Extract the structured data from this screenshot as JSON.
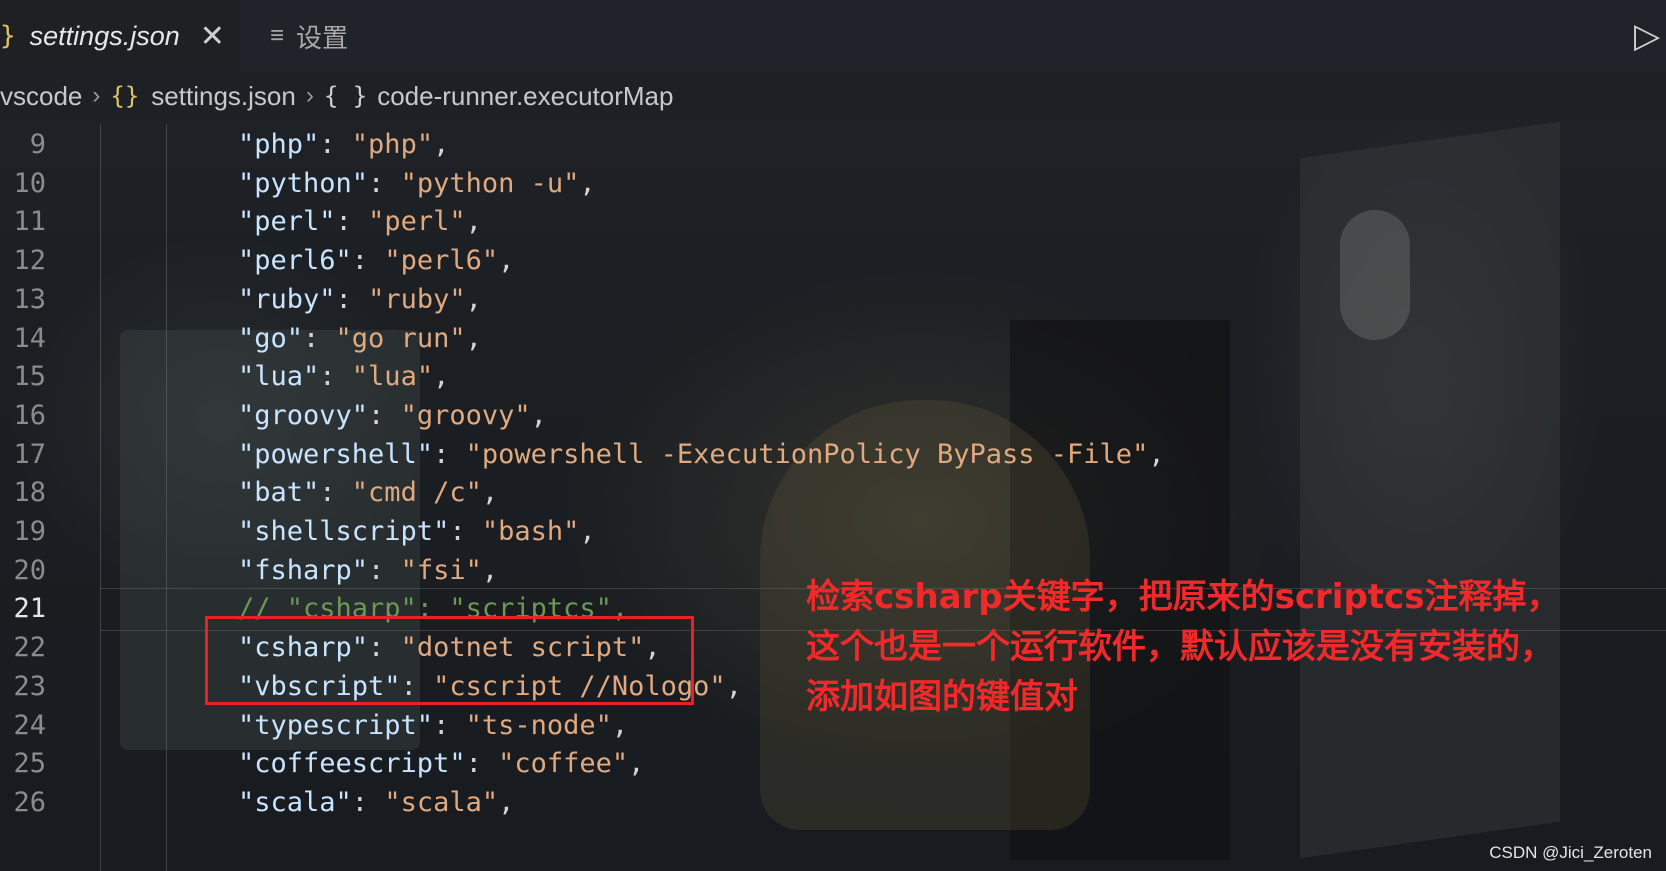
{
  "tabs": {
    "active": {
      "icon": "json-braces-icon",
      "icon_glyph": "}",
      "title": "settings.json",
      "close": "✕"
    },
    "settings": {
      "icon": "menu-lines-icon",
      "icon_glyph": "≡",
      "title": "设置"
    },
    "run_glyph": "▷"
  },
  "breadcrumb": {
    "folder": "vscode",
    "sep1": "›",
    "file_icon": "{}",
    "file": "settings.json",
    "sep2": "›",
    "obj_icon": "{ }",
    "key": "code-runner.executorMap"
  },
  "lines": [
    {
      "n": "9",
      "k": "\"php\"",
      "v": "\"php\""
    },
    {
      "n": "10",
      "k": "\"python\"",
      "v": "\"python -u\""
    },
    {
      "n": "11",
      "k": "\"perl\"",
      "v": "\"perl\""
    },
    {
      "n": "12",
      "k": "\"perl6\"",
      "v": "\"perl6\""
    },
    {
      "n": "13",
      "k": "\"ruby\"",
      "v": "\"ruby\""
    },
    {
      "n": "14",
      "k": "\"go\"",
      "v": "\"go run\""
    },
    {
      "n": "15",
      "k": "\"lua\"",
      "v": "\"lua\""
    },
    {
      "n": "16",
      "k": "\"groovy\"",
      "v": "\"groovy\""
    },
    {
      "n": "17",
      "k": "\"powershell\"",
      "v": "\"powershell -ExecutionPolicy ByPass -File\""
    },
    {
      "n": "18",
      "k": "\"bat\"",
      "v": "\"cmd /c\""
    },
    {
      "n": "19",
      "k": "\"shellscript\"",
      "v": "\"bash\""
    },
    {
      "n": "20",
      "k": "\"fsharp\"",
      "v": "\"fsi\""
    },
    {
      "n": "21",
      "comment": "// \"csharp\": \"scriptcs\","
    },
    {
      "n": "22",
      "k": "\"csharp\"",
      "v": "\"dotnet script\""
    },
    {
      "n": "23",
      "k": "\"vbscript\"",
      "v": "\"cscript //Nologo\""
    },
    {
      "n": "24",
      "k": "\"typescript\"",
      "v": "\"ts-node\""
    },
    {
      "n": "25",
      "k": "\"coffeescript\"",
      "v": "\"coffee\""
    },
    {
      "n": "26",
      "k": "\"scala\"",
      "v": "\"scala\""
    }
  ],
  "annotation": {
    "line1": "检索csharp关键字，把原来的scriptcs注释掉，",
    "line2": "这个也是一个运行软件，默认应该是没有安装的，",
    "line3": "添加如图的键值对"
  },
  "watermark": "CSDN @Jici_Zeroten",
  "colors": {
    "highlight_box": "#e8202a",
    "annotation_text": "#f02a2a",
    "json_icon": "#e2c069"
  }
}
